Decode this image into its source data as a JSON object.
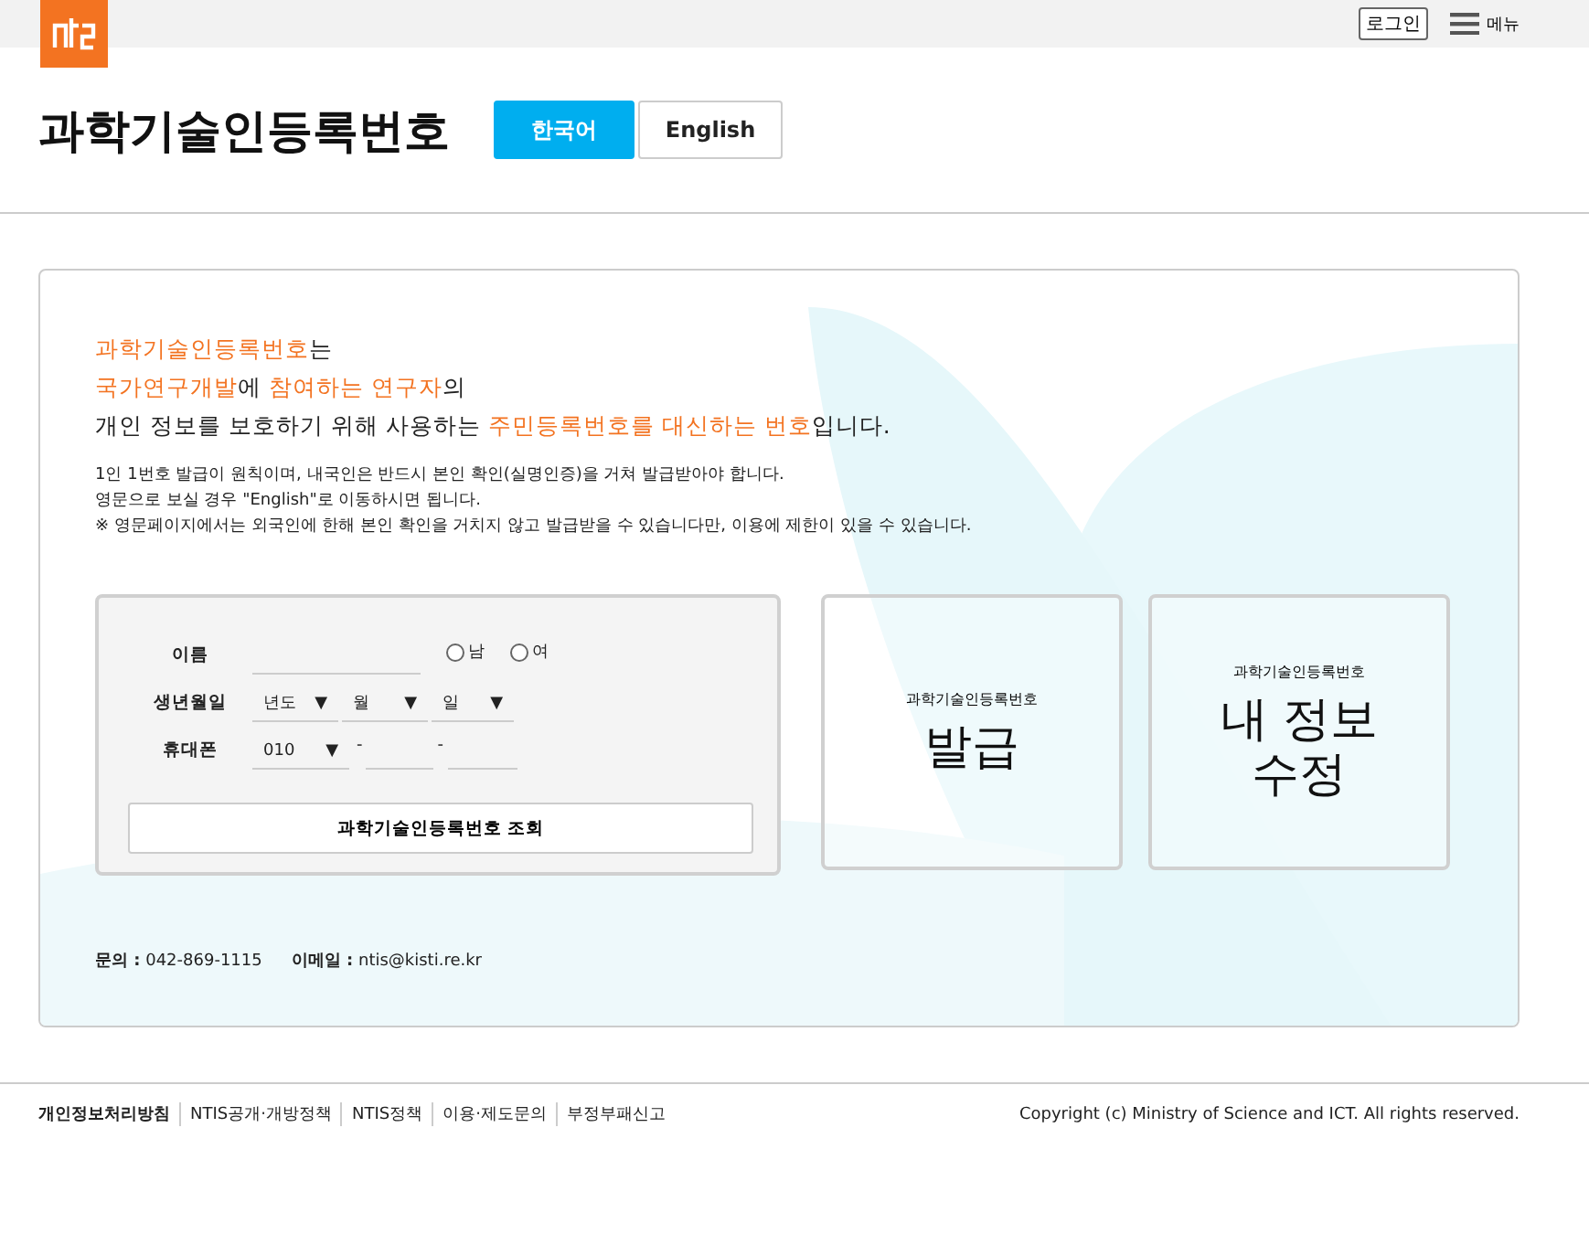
{
  "top_bar": {
    "login": "로그인",
    "menu": "메뉴"
  },
  "header": {
    "title": "과학기술인등록번호",
    "languages": [
      {
        "label": "한국어",
        "selected": true
      },
      {
        "label": "English",
        "selected": false
      }
    ]
  },
  "intro": [
    "**과학기술인등록번호**는",
    "**국가연구개발**에 **참여하는 연구자**의",
    "개인 정보를 보호하기 위해 사용하는 **주민등록번호를 대신하는 번호**입니다."
  ],
  "notes": [
    "1인 1번호 발급이 원칙이며, 내국인은 반드시 본인 확인(실명인증)을 거쳐 발급받아야 합니다.",
    "영문으로 보실 경우 \"English\"로 이동하시면 됩니다.",
    "※ 영문페이지에서는 외국인에 한해 본인 확인을 거치지 않고 발급받을 수 있습니다만, 이용에 제한이 있을 수 있습니다."
  ],
  "form": {
    "name_label": "이름",
    "genders": [
      {
        "label": "남",
        "selected": false
      },
      {
        "label": "여",
        "selected": false
      }
    ],
    "birth_label": "생년월일",
    "birth_selects": [
      {
        "value": "년도",
        "caret": "▼"
      },
      {
        "value": "월",
        "caret": "▼"
      },
      {
        "value": "일",
        "caret": "▼"
      }
    ],
    "phone_label": "휴대폰",
    "phone_prefix": {
      "value": "010",
      "caret": "▼"
    },
    "phone_dashes": [
      "-",
      "-"
    ],
    "submit": "과학기술인등록번호 조회"
  },
  "cards": [
    {
      "caption": "과학기술인등록번호",
      "lines": [
        "발급"
      ]
    },
    {
      "caption": "과학기술인등록번호",
      "lines": [
        "내 정보",
        "수정"
      ]
    }
  ],
  "contact": [
    {
      "label": "문의 :",
      "value": "042-869-1115"
    },
    {
      "label": "이메일 :",
      "value": "ntis@kisti.re.kr"
    }
  ],
  "footer": {
    "links": [
      {
        "label": "개인정보처리방침",
        "bold": true
      },
      {
        "label": "NTIS공개·개방정책",
        "bold": false
      },
      {
        "label": "NTIS정책",
        "bold": false
      },
      {
        "label": "이용·제도문의",
        "bold": false
      },
      {
        "label": "부정부패신고",
        "bold": false
      }
    ],
    "copyright": "Copyright (c) Ministry of Science and ICT. All rights reserved."
  }
}
